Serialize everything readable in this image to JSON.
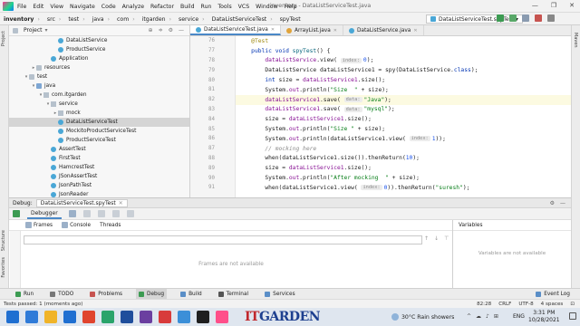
{
  "menubar": {
    "items": [
      "File",
      "Edit",
      "View",
      "Navigate",
      "Code",
      "Analyze",
      "Refactor",
      "Build",
      "Run",
      "Tools",
      "VCS",
      "Window",
      "Help"
    ],
    "window_title": "inventory - DataListServiceTest.java",
    "controls": [
      "—",
      "❐",
      "✕"
    ]
  },
  "navbar": {
    "crumbs": [
      "inventory",
      "src",
      "test",
      "java",
      "com",
      "itgarden",
      "service",
      "DataListServiceTest",
      "spyTest"
    ],
    "run_config": "DataListServiceTest.spyTest ▾"
  },
  "left_strip": {
    "labels": [
      "Project",
      "Structure",
      "Favorites"
    ]
  },
  "right_strip": {
    "labels": [
      "Maven"
    ]
  },
  "project": {
    "header": "Project",
    "header_icons": [
      "⊕",
      "≑",
      "⚙",
      "—"
    ],
    "tree": [
      {
        "label": "DataListService",
        "indent": 6,
        "icon": "cls",
        "caret": ""
      },
      {
        "label": "ProductService",
        "indent": 6,
        "icon": "cls",
        "caret": ""
      },
      {
        "label": "Application",
        "indent": 5,
        "icon": "cls",
        "caret": ""
      },
      {
        "label": "resources",
        "indent": 3,
        "icon": "fold",
        "caret": "▸"
      },
      {
        "label": "test",
        "indent": 2,
        "icon": "fold",
        "caret": "▾"
      },
      {
        "label": "java",
        "indent": 3,
        "icon": "foldb",
        "caret": "▾"
      },
      {
        "label": "com.itgarden",
        "indent": 4,
        "icon": "pkg",
        "caret": "▾"
      },
      {
        "label": "service",
        "indent": 5,
        "icon": "pkg",
        "caret": "▾"
      },
      {
        "label": "mock",
        "indent": 6,
        "icon": "pkg",
        "caret": "▸"
      },
      {
        "label": "DataListServiceTest",
        "indent": 6,
        "icon": "cls",
        "caret": "",
        "selected": true
      },
      {
        "label": "MockitoProductServiceTest",
        "indent": 6,
        "icon": "cls",
        "caret": ""
      },
      {
        "label": "ProductServiceTest",
        "indent": 6,
        "icon": "cls",
        "caret": ""
      },
      {
        "label": "AssertTest",
        "indent": 5,
        "icon": "cls",
        "caret": ""
      },
      {
        "label": "FirstTest",
        "indent": 5,
        "icon": "cls",
        "caret": ""
      },
      {
        "label": "HamcrestTest",
        "indent": 5,
        "icon": "cls",
        "caret": ""
      },
      {
        "label": "JSonAssertTest",
        "indent": 5,
        "icon": "cls",
        "caret": ""
      },
      {
        "label": "JsonPathTest",
        "indent": 5,
        "icon": "cls",
        "caret": ""
      },
      {
        "label": "JsonReader",
        "indent": 5,
        "icon": "cls",
        "caret": ""
      }
    ]
  },
  "editor": {
    "tabs": [
      {
        "label": "DataListServiceTest.java",
        "active": true,
        "color": "#4aa7d6"
      },
      {
        "label": "ArrayList.java",
        "active": false,
        "color": "#e0a33a"
      },
      {
        "label": "DataListService.java",
        "active": false,
        "color": "#4aa7d6"
      }
    ],
    "line_numbers": [
      "76",
      "77",
      "78",
      "79",
      "80",
      "81",
      "82",
      "83",
      "84",
      "85",
      "86",
      "87",
      "88",
      "89",
      "90",
      "91"
    ],
    "gutter_marks": {
      "77": "#3c9b52",
      "82": "#e8b93a"
    },
    "highlight_line": 6,
    "code_lines": [
      [
        {
          "c": "ann",
          "t": "    @Test"
        }
      ],
      [
        {
          "c": "kw",
          "t": "    public void "
        },
        {
          "c": "fn",
          "t": "spyTest"
        },
        {
          "t": "() {"
        }
      ],
      [
        {
          "t": "        "
        },
        {
          "c": "fld",
          "t": "dataListService"
        },
        {
          "t": ".view( "
        },
        {
          "c": "hint",
          "t": "index:"
        },
        {
          "c": "num",
          "t": "0"
        },
        {
          "t": ");"
        }
      ],
      [
        {
          "t": "        DataListService dataListService1 = spy(DataListService."
        },
        {
          "c": "kw",
          "t": "class"
        },
        {
          "t": ");"
        }
      ],
      [
        {
          "c": "kw",
          "t": "        int "
        },
        {
          "t": "size = "
        },
        {
          "c": "fld",
          "t": "dataListService1"
        },
        {
          "t": ".size();"
        }
      ],
      [
        {
          "t": "        System."
        },
        {
          "c": "fld",
          "t": "out"
        },
        {
          "t": ".println("
        },
        {
          "c": "str",
          "t": "\"Size  \""
        },
        {
          "t": " + size);"
        }
      ],
      [
        {
          "t": "        "
        },
        {
          "c": "fld",
          "t": "dataListService1"
        },
        {
          "t": ".save( "
        },
        {
          "c": "hint",
          "t": "data:"
        },
        {
          "c": "str",
          "t": "\"Java\""
        },
        {
          "t": ");"
        }
      ],
      [
        {
          "t": "        "
        },
        {
          "c": "fld",
          "t": "dataListService1"
        },
        {
          "t": ".save( "
        },
        {
          "c": "hint",
          "t": "data:"
        },
        {
          "c": "str",
          "t": "\"mysql\""
        },
        {
          "t": ");"
        }
      ],
      [
        {
          "t": "        size = "
        },
        {
          "c": "fld",
          "t": "dataListService1"
        },
        {
          "t": ".size();"
        }
      ],
      [
        {
          "t": "        System."
        },
        {
          "c": "fld",
          "t": "out"
        },
        {
          "t": ".println("
        },
        {
          "c": "str",
          "t": "\"Size \""
        },
        {
          "t": " + size);"
        }
      ],
      [
        {
          "t": "        System."
        },
        {
          "c": "fld",
          "t": "out"
        },
        {
          "t": ".println(dataListService1.view( "
        },
        {
          "c": "hint",
          "t": "index:"
        },
        {
          "c": "num",
          "t": "1"
        },
        {
          "t": "));"
        }
      ],
      [
        {
          "c": "cmt",
          "t": "        // mocking here"
        }
      ],
      [
        {
          "t": "        when(dataListService1.size()).thenReturn("
        },
        {
          "c": "num",
          "t": "10"
        },
        {
          "t": ");"
        }
      ],
      [
        {
          "t": "        size = "
        },
        {
          "c": "fld",
          "t": "dataListService1"
        },
        {
          "t": ".size();"
        }
      ],
      [
        {
          "t": "        System."
        },
        {
          "c": "fld",
          "t": "out"
        },
        {
          "t": ".println("
        },
        {
          "c": "str",
          "t": "\"After mocking  \""
        },
        {
          "t": " + size);"
        }
      ],
      [
        {
          "t": "        when(dataListService1.view( "
        },
        {
          "c": "hint",
          "t": "index:"
        },
        {
          "c": "num",
          "t": "0"
        },
        {
          "t": ")).thenReturn("
        },
        {
          "c": "str",
          "t": "\"suresh\""
        },
        {
          "t": ");"
        }
      ]
    ]
  },
  "debug": {
    "label": "Debug:",
    "config_tab": "DataListServiceTest.spyTest",
    "right_icons": [
      "⚙",
      "—"
    ],
    "debugger_tab": "Debugger",
    "sub_tabs": [
      "Frames",
      "Console",
      "Threads"
    ],
    "frames_empty": "Frames are not available",
    "variables_title": "Variables",
    "variables_empty": "Variables are not available",
    "frame_nav": [
      "↑",
      "↓",
      "⊤"
    ]
  },
  "bottom_tools": {
    "items": [
      {
        "label": "Run",
        "color": "#3c9b52",
        "active": false
      },
      {
        "label": "TODO",
        "color": "#777",
        "active": false
      },
      {
        "label": "Problems",
        "color": "#c75450",
        "active": false
      },
      {
        "label": "Debug",
        "color": "#3c9b52",
        "active": true
      },
      {
        "label": "Build",
        "color": "#5a8ec7",
        "active": false
      },
      {
        "label": "Terminal",
        "color": "#555",
        "active": false
      },
      {
        "label": "Services",
        "color": "#5a8ec7",
        "active": false
      }
    ],
    "event_log": "Event Log"
  },
  "statusbar": {
    "message": "Tests passed: 1 (moments ago)",
    "right": [
      "82:28",
      "CRLF",
      "UTF-8",
      "4 spaces",
      "⊡"
    ]
  },
  "taskbar": {
    "apps": [
      "#2f7bd8",
      "#f0b429",
      "#1f6fd1",
      "#e0442e",
      "#2aa46b",
      "#1f4e9c",
      "#6b3fa0",
      "#d83b3b",
      "#3b8fd8",
      "#1f1f1f",
      "#ff4f8a"
    ],
    "brand_red": "IT",
    "brand_blue": "GARDEN",
    "weather": "30°C  Rain showers",
    "lang": "ENG",
    "time": "3:31 PM",
    "date": "10/28/2021",
    "tray": [
      "^",
      "☁",
      "♪",
      "⊞"
    ]
  }
}
